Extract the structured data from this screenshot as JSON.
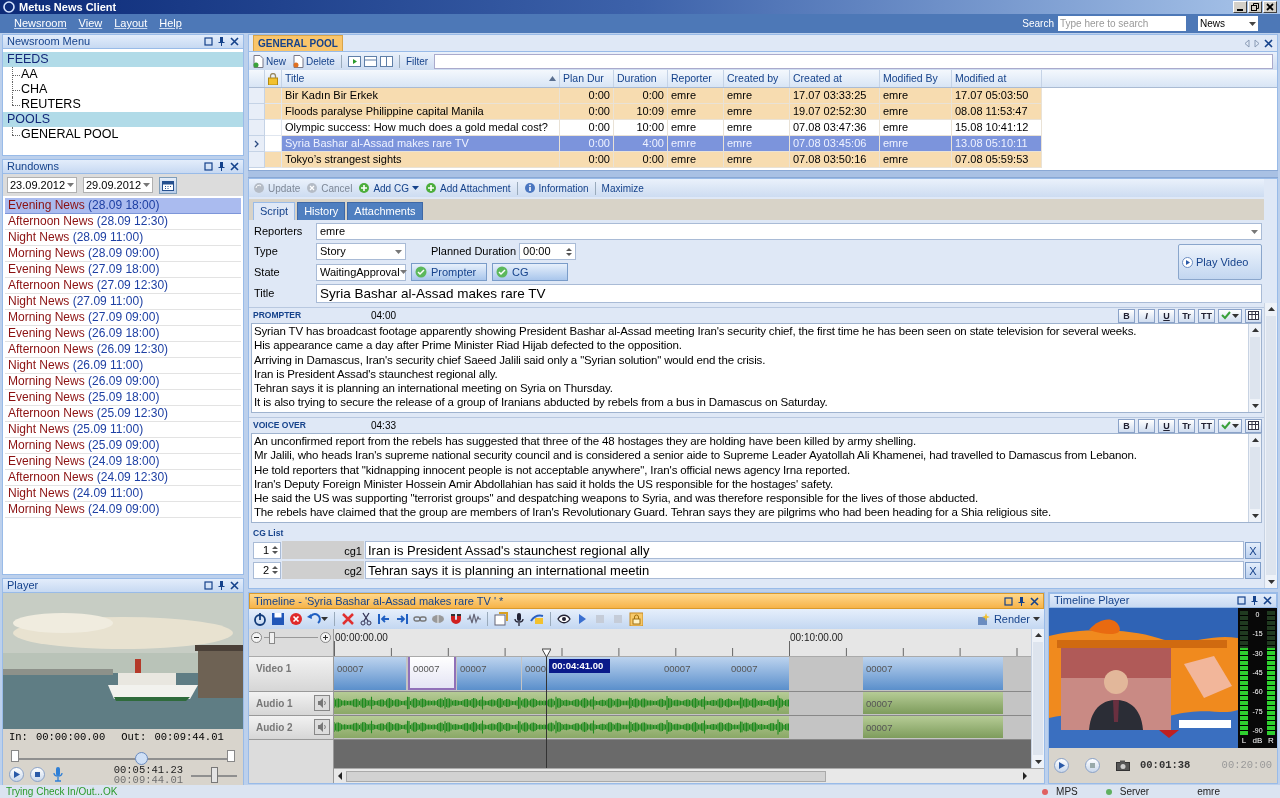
{
  "window": {
    "title": "Metus News Client"
  },
  "menu": [
    "Newsroom",
    "View",
    "Layout",
    "Help"
  ],
  "search": {
    "label": "Search",
    "placeholder": "Type here to search",
    "scope": "News"
  },
  "newsroom_menu": {
    "title": "Newsroom Menu",
    "groups": [
      {
        "label": "FEEDS",
        "children": [
          {
            "label": "AA"
          },
          {
            "label": "CHA"
          },
          {
            "label": "REUTERS"
          }
        ]
      },
      {
        "label": "POOLS",
        "children": [
          {
            "label": "GENERAL POOL"
          }
        ]
      }
    ]
  },
  "rundowns": {
    "title": "Rundowns",
    "from": "23.09.2012",
    "to": "29.09.2012",
    "items": [
      {
        "name": "Evening News",
        "date": "(28.09 18:00)",
        "selected": true
      },
      {
        "name": "Afternoon News",
        "date": "(28.09 12:30)",
        "selected": false
      },
      {
        "name": "Night News",
        "date": "(28.09 11:00)",
        "selected": false
      },
      {
        "name": "Morning News",
        "date": "(28.09 09:00)",
        "selected": false
      },
      {
        "name": "Evening News",
        "date": "(27.09 18:00)",
        "selected": false
      },
      {
        "name": "Afternoon News",
        "date": "(27.09 12:30)",
        "selected": false
      },
      {
        "name": "Night News",
        "date": "(27.09 11:00)",
        "selected": false
      },
      {
        "name": "Morning News",
        "date": "(27.09 09:00)",
        "selected": false
      },
      {
        "name": "Evening News",
        "date": "(26.09 18:00)",
        "selected": false
      },
      {
        "name": "Afternoon News",
        "date": "(26.09 12:30)",
        "selected": false
      },
      {
        "name": "Night News",
        "date": "(26.09 11:00)",
        "selected": false
      },
      {
        "name": "Morning News",
        "date": "(26.09 09:00)",
        "selected": false
      },
      {
        "name": "Evening News",
        "date": "(25.09 18:00)",
        "selected": false
      },
      {
        "name": "Afternoon News",
        "date": "(25.09 12:30)",
        "selected": false
      },
      {
        "name": "Night News",
        "date": "(25.09 11:00)",
        "selected": false
      },
      {
        "name": "Morning News",
        "date": "(25.09 09:00)",
        "selected": false
      },
      {
        "name": "Evening News",
        "date": "(24.09 18:00)",
        "selected": false
      },
      {
        "name": "Afternoon News",
        "date": "(24.09 12:30)",
        "selected": false
      },
      {
        "name": "Night News",
        "date": "(24.09 11:00)",
        "selected": false
      },
      {
        "name": "Morning News",
        "date": "(24.09 09:00)",
        "selected": false
      }
    ]
  },
  "player": {
    "title": "Player",
    "in_label": "In:",
    "in": "00:00:00.00",
    "out_label": "Out:",
    "out": "00:09:44.01",
    "seek": {
      "level": 0.58
    },
    "position": "00:05:41.23",
    "duration": "00:09:44.01",
    "volume": {
      "level": 0.5
    }
  },
  "pool": {
    "tab": "GENERAL POOL",
    "new": "New",
    "delete": "Delete",
    "filter": "Filter",
    "columns": [
      {
        "label": "Title",
        "sorted": true
      },
      {
        "label": "Plan Dur",
        "sorted": false
      },
      {
        "label": "Duration",
        "sorted": false
      },
      {
        "label": "Reporter",
        "sorted": false
      },
      {
        "label": "Created by",
        "sorted": false
      },
      {
        "label": "Created at",
        "sorted": false
      },
      {
        "label": "Modified By",
        "sorted": false
      },
      {
        "label": "Modified at",
        "sorted": false
      }
    ],
    "rows": [
      {
        "cells": [
          "Bir Kadın Bir Erkek",
          "0:00",
          "0:00",
          "emre",
          "emre",
          "17.07 03:33:25",
          "emre",
          "17.07 05:03:50"
        ],
        "highlighted": true,
        "selected": false
      },
      {
        "cells": [
          "Floods paralyse Philippine capital Manila",
          "0:00",
          "10:09",
          "emre",
          "emre",
          "19.07 02:52:30",
          "emre",
          "08.08 11:53:47"
        ],
        "highlighted": true,
        "selected": false
      },
      {
        "cells": [
          "Olympic success: How much does a gold medal cost?",
          "0:00",
          "10:00",
          "emre",
          "emre",
          "07.08 03:47:36",
          "emre",
          "15.08 10:41:12"
        ],
        "highlighted": false,
        "selected": false
      },
      {
        "cells": [
          "Syria Bashar al-Assad makes rare TV",
          "0:00",
          "4:00",
          "emre",
          "emre",
          "07.08 03:45:06",
          "emre",
          "13.08 05:10:11"
        ],
        "highlighted": false,
        "selected": true
      },
      {
        "cells": [
          "Tokyo’s strangest sights",
          "0:00",
          "0:00",
          "emre",
          "emre",
          "07.08 03:50:16",
          "emre",
          "07.08 05:59:53"
        ],
        "highlighted": true,
        "selected": false
      }
    ]
  },
  "detail": {
    "actions": [
      {
        "label": "Update",
        "kind": "update",
        "disabled": true
      },
      {
        "label": "Cancel",
        "kind": "cancel",
        "disabled": true
      },
      {
        "label": "Add CG",
        "kind": "add",
        "disabled": false,
        "dropdown": true
      },
      {
        "label": "Add Attachment",
        "kind": "add",
        "disabled": false
      },
      {
        "label": "Information",
        "kind": "info",
        "disabled": false
      },
      {
        "label": "Maximize",
        "kind": "text",
        "disabled": false
      }
    ],
    "tabs": [
      {
        "label": "Script",
        "selected": true
      },
      {
        "label": "History",
        "selected": false
      },
      {
        "label": "Attachments",
        "selected": false
      }
    ],
    "reporters_label": "Reporters",
    "reporters": "emre",
    "type_label": "Type",
    "type": "Story",
    "planned_label": "Planned Duration",
    "planned": "00:00",
    "state_label": "State",
    "state": "WaitingApproval",
    "toggles": [
      {
        "label": "Prompter",
        "checked": true
      },
      {
        "label": "CG",
        "checked": true
      }
    ],
    "play_video": "Play Video",
    "title_label": "Title",
    "title": "Syria Bashar al-Assad makes rare TV",
    "sections": [
      {
        "label": "PROMPTER",
        "duration": "04:00",
        "format_buttons": [
          "B",
          "I",
          "U",
          "Tr",
          "TT"
        ],
        "lines": [
          "Syrian TV has broadcast footage apparently showing President Bashar al-Assad meeting Iran's security chief, the first time he has been seen on state television for several weeks.",
          "His appearance came a day after Prime Minister Riad Hijab defected to the opposition.",
          "Arriving in Damascus, Iran's security chief Saeed Jalili said only a \"Syrian solution\" would end the crisis.",
          "Iran is President Assad's staunchest regional ally.",
          "Tehran says it is planning an international meeting on Syria on Thursday.",
          "It is also trying to secure the release of a group of Iranians abducted by rebels from a bus in Damascus on Saturday."
        ]
      },
      {
        "label": "VOICE OVER",
        "duration": "04:33",
        "format_buttons": [
          "B",
          "I",
          "U",
          "Tr",
          "TT"
        ],
        "lines": [
          "An unconfirmed report from the rebels has suggested that three of the 48 hostages they are holding have been killed by army shelling.",
          "Mr Jalili, who heads Iran's supreme national security council and is considered a senior aide to Supreme Leader Ayatollah Ali Khamenei, had travelled to Damascus from Lebanon.",
          "He told reporters that \"kidnapping innocent people is not acceptable anywhere\", Iran's official news agency Irna reported.",
          "Iran's Deputy Foreign Minister Hossein Amir Abdollahian has said it holds the US responsible for the hostages' safety.",
          "He said the US was supporting \"terrorist groups\" and despatching weapons to Syria, and was therefore responsible for the lives of those abducted.",
          "The rebels have claimed that the group are members of Iran's Revolutionary Guard. Tehran says they are pilgrims who had been heading for a Shia religious site."
        ]
      }
    ],
    "cg_list": {
      "label": "CG List",
      "rows": [
        {
          "number": "1",
          "id": "cg1",
          "text": "Iran is President Assad's staunchest regional ally",
          "remove": "X"
        },
        {
          "number": "2",
          "id": "cg2",
          "text": "Tehran says it is planning an international meetin",
          "remove": "X"
        }
      ]
    }
  },
  "timeline": {
    "title": "Timeline - 'Syria Bashar al-Assad makes rare TV ' *",
    "render": "Render",
    "zoom": {
      "level": 0.15
    },
    "ruler": [
      "00:00:00.00",
      "00:10:00.00"
    ],
    "marker": "00:04:41.00",
    "tracks": [
      {
        "name": "Video 1",
        "kind": "video",
        "clips": [
          {
            "label": "00007",
            "selected": false
          },
          {
            "label": "00007",
            "selected": true
          },
          {
            "label": "00007",
            "selected": false
          },
          {
            "label": "0000",
            "selected": false
          },
          {
            "label": "00007",
            "selected": false
          },
          {
            "label": "00007",
            "selected": false
          },
          {
            "label": "00007",
            "selected": false
          }
        ]
      },
      {
        "name": "Audio 1",
        "kind": "audio",
        "clips": [
          {
            "label": "00007",
            "selected": false
          }
        ]
      },
      {
        "name": "Audio 2",
        "kind": "audio",
        "clips": [
          {
            "label": "00007",
            "selected": false
          }
        ]
      }
    ]
  },
  "timeline_player": {
    "title": "Timeline Player",
    "scale": [
      "0",
      "-15",
      "-30",
      "-45",
      "-60",
      "-75",
      "-90"
    ],
    "channels": [
      "L",
      "dB",
      "R"
    ],
    "meters": [
      {
        "level": 0.7
      },
      {
        "level": 0.7
      }
    ],
    "position": "00:01:38",
    "duration": "00:20:00"
  },
  "status_bar": {
    "message": "Trying Check In/Out...OK",
    "indicators": [
      {
        "label": "MPS",
        "color": "#e06060"
      },
      {
        "label": "Server",
        "color": "#60b060"
      }
    ],
    "user": "emre"
  }
}
